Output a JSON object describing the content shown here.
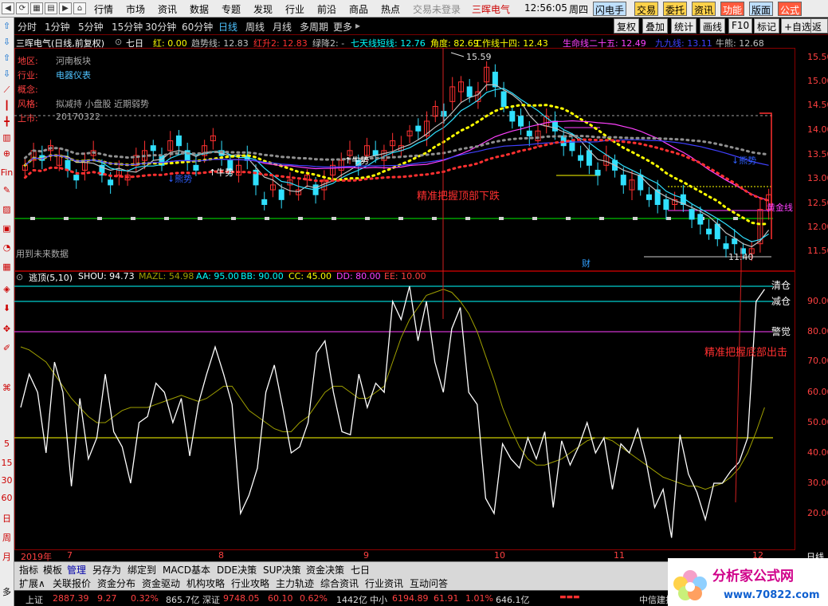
{
  "menubar": {
    "items": [
      "行情",
      "市场",
      "资讯",
      "数据",
      "专题",
      "发现",
      "行业",
      "前沿",
      "商品",
      "热点"
    ],
    "login_status": "交易未登录",
    "app_name": "三晖电气",
    "time": "12:56:05",
    "weekday": "周四",
    "buttons": [
      "闪电手",
      "交易",
      "委托",
      "资讯",
      "功能",
      "版面",
      "公式"
    ]
  },
  "leftbar": {
    "labels": [
      "Fin",
      "5",
      "15",
      "30",
      "60",
      "日",
      "周",
      "月",
      "多"
    ]
  },
  "timeframes": [
    "分时",
    "1分钟",
    "5分钟",
    "15分钟",
    "30分钟",
    "60分钟",
    "日线",
    "周线",
    "月线",
    "多周期",
    "更多"
  ],
  "active_timeframe": "日线",
  "tools": [
    "复权",
    "叠加",
    "统计",
    "画线",
    "F10",
    "标记",
    "+自选",
    "返回"
  ],
  "header": {
    "title": "三晖电气(日线,前复权)",
    "period": "七日",
    "items": [
      {
        "label": "红: 0.00",
        "color": "#ffff00"
      },
      {
        "label": "趋势线: 12.83",
        "color": "#c0c0c0"
      },
      {
        "label": "红升2: 12.83",
        "color": "#ff3030"
      },
      {
        "label": "绿降2: -",
        "color": "#c0c0c0"
      },
      {
        "label": "七天线短线: 12.76",
        "color": "#00ffff"
      },
      {
        "label": "角度: 82.69",
        "color": "#ffff00"
      },
      {
        "label": "工作线十四: 12.43",
        "color": "#ffff00"
      },
      {
        "label": "生命线二十五: 12.49",
        "color": "#ff40ff"
      },
      {
        "label": "九九线: 13.11",
        "color": "#4040ff"
      },
      {
        "label": "牛熊: 12.68",
        "color": "#c0c0c0"
      }
    ]
  },
  "info": {
    "rows": [
      {
        "key": "地区:",
        "value": "河南板块"
      },
      {
        "key": "行业:",
        "value": "电器仪表"
      },
      {
        "key": "概念:",
        "value": ""
      },
      {
        "key": "风格:",
        "value": "拟减持 小盘股 近期弱势"
      },
      {
        "key": "上市:",
        "value": "20170322"
      }
    ]
  },
  "annotations": {
    "high_label": "15.59",
    "low_label": "11.40",
    "top_call": "精准把握顶部下跌",
    "bottom_call": "精准把握底部出击",
    "future_data": "用到未来数据",
    "cai": "财",
    "bull1": "↑牛势",
    "bull2": "↑牛势",
    "bear1": "↓熊势",
    "bear2": "↓熊势",
    "gold_line": "黄金线",
    "qingcang": "清仓",
    "jiancang": "减仓",
    "jingjue": "警觉"
  },
  "yaxis_main": [
    "15.50",
    "15.00",
    "14.50",
    "14.00",
    "13.50",
    "13.00",
    "12.50",
    "12.00",
    "11.50"
  ],
  "yaxis_sub": [
    "90.00",
    "80.00",
    "70.00",
    "60.00",
    "50.00",
    "40.00",
    "30.00",
    "20.00"
  ],
  "sub_legend": [
    {
      "label": "逃顶(5,10)",
      "color": "#ffffff"
    },
    {
      "label": "SHOU: 94.73",
      "color": "#ffffff"
    },
    {
      "label": "MAZL: 54.98",
      "color": "#a0a000"
    },
    {
      "label": "AA: 95.00",
      "color": "#00ffff"
    },
    {
      "label": "BB: 90.00",
      "color": "#00ffff"
    },
    {
      "label": "CC: 45.00",
      "color": "#ffff00"
    },
    {
      "label": "DD: 80.00",
      "color": "#ff40ff"
    },
    {
      "label": "EE: 10.00",
      "color": "#ff4040"
    }
  ],
  "xaxis": [
    "2019年",
    "7",
    "8",
    "9",
    "10",
    "11",
    "12"
  ],
  "xaxis_right": "日线",
  "tabs1": [
    "指标",
    "模板",
    "管理",
    "另存为",
    "绑定到",
    "MACD基本",
    "DDE决策",
    "SUP决策",
    "资金决策",
    "七日"
  ],
  "tabs2": [
    "扩展∧",
    "关联报价",
    "资金分布",
    "资金驱动",
    "机构攻略",
    "行业攻略",
    "主力轨迹",
    "综合资讯",
    "行业资讯",
    "互动问答"
  ],
  "status": {
    "items": [
      {
        "label": "上证",
        "color": "#ddd"
      },
      {
        "label": "2887.39",
        "color": "#ff4040"
      },
      {
        "label": "9.27",
        "color": "#ff4040"
      },
      {
        "label": "0.32%",
        "color": "#ff4040"
      },
      {
        "label": "865.7亿",
        "color": "#ddd"
      },
      {
        "label": "深证",
        "color": "#ddd"
      },
      {
        "label": "9748.05",
        "color": "#ff4040"
      },
      {
        "label": "60.10",
        "color": "#ff4040"
      },
      {
        "label": "0.62%",
        "color": "#ff4040"
      },
      {
        "label": "1442亿",
        "color": "#ddd"
      },
      {
        "label": "中小",
        "color": "#ddd"
      },
      {
        "label": "6194.89",
        "color": "#ff4040"
      },
      {
        "label": "61.91",
        "color": "#ff4040"
      },
      {
        "label": "1.01%",
        "color": "#ff4040"
      },
      {
        "label": "646.1亿",
        "color": "#ddd"
      },
      {
        "label": "中信建投",
        "color": "#ddd"
      }
    ]
  },
  "logo": {
    "text": "分析家公式网",
    "url": "www.70822.com"
  }
}
